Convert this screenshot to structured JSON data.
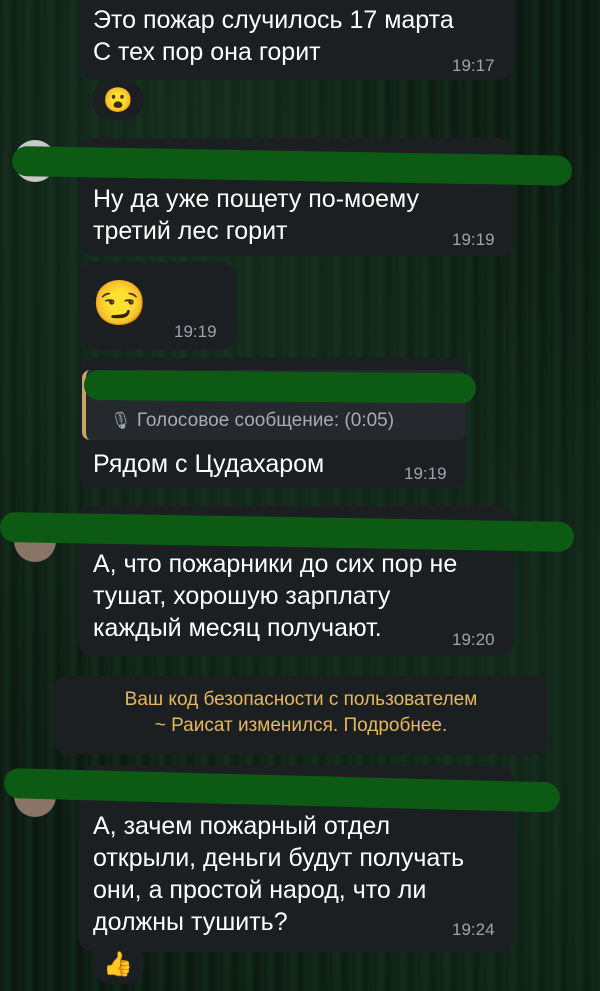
{
  "messages": [
    {
      "text_lines": [
        "Это пожар случилось 17 марта",
        "С тех пор она горит"
      ],
      "time": "19:17",
      "reaction": "😮"
    },
    {
      "text_lines": [
        "Ну да уже пощету по-моему",
        "третий лес горит"
      ],
      "time": "19:19"
    },
    {
      "emoji": "😏",
      "time": "19:19"
    },
    {
      "reply_label": "Голосовое сообщение: (0:05)",
      "text": "Рядом с Цудахаром",
      "time": "19:19"
    },
    {
      "text_lines": [
        "А, что пожарники до сих пор не",
        "тушат, хорошую зарплату",
        "каждый месяц получают."
      ],
      "time": "19:20"
    },
    {
      "text_lines": [
        "А, зачем пожарный отдел",
        "открыли, деньги будут получать",
        "они, а простой народ, что ли",
        "должны тушить?"
      ],
      "time": "19:24",
      "reaction": "👍"
    }
  ],
  "system_notice": {
    "line1": "Ваш код безопасности с пользователем",
    "line2": "~ Раисат изменился. Подробнее."
  },
  "colors": {
    "bubble": "#1c1f22",
    "notice": "#e6b85a",
    "scribble": "#0d5a14",
    "quote_bar": "#c8a165"
  },
  "icons": {
    "mic": "microphone-icon"
  }
}
